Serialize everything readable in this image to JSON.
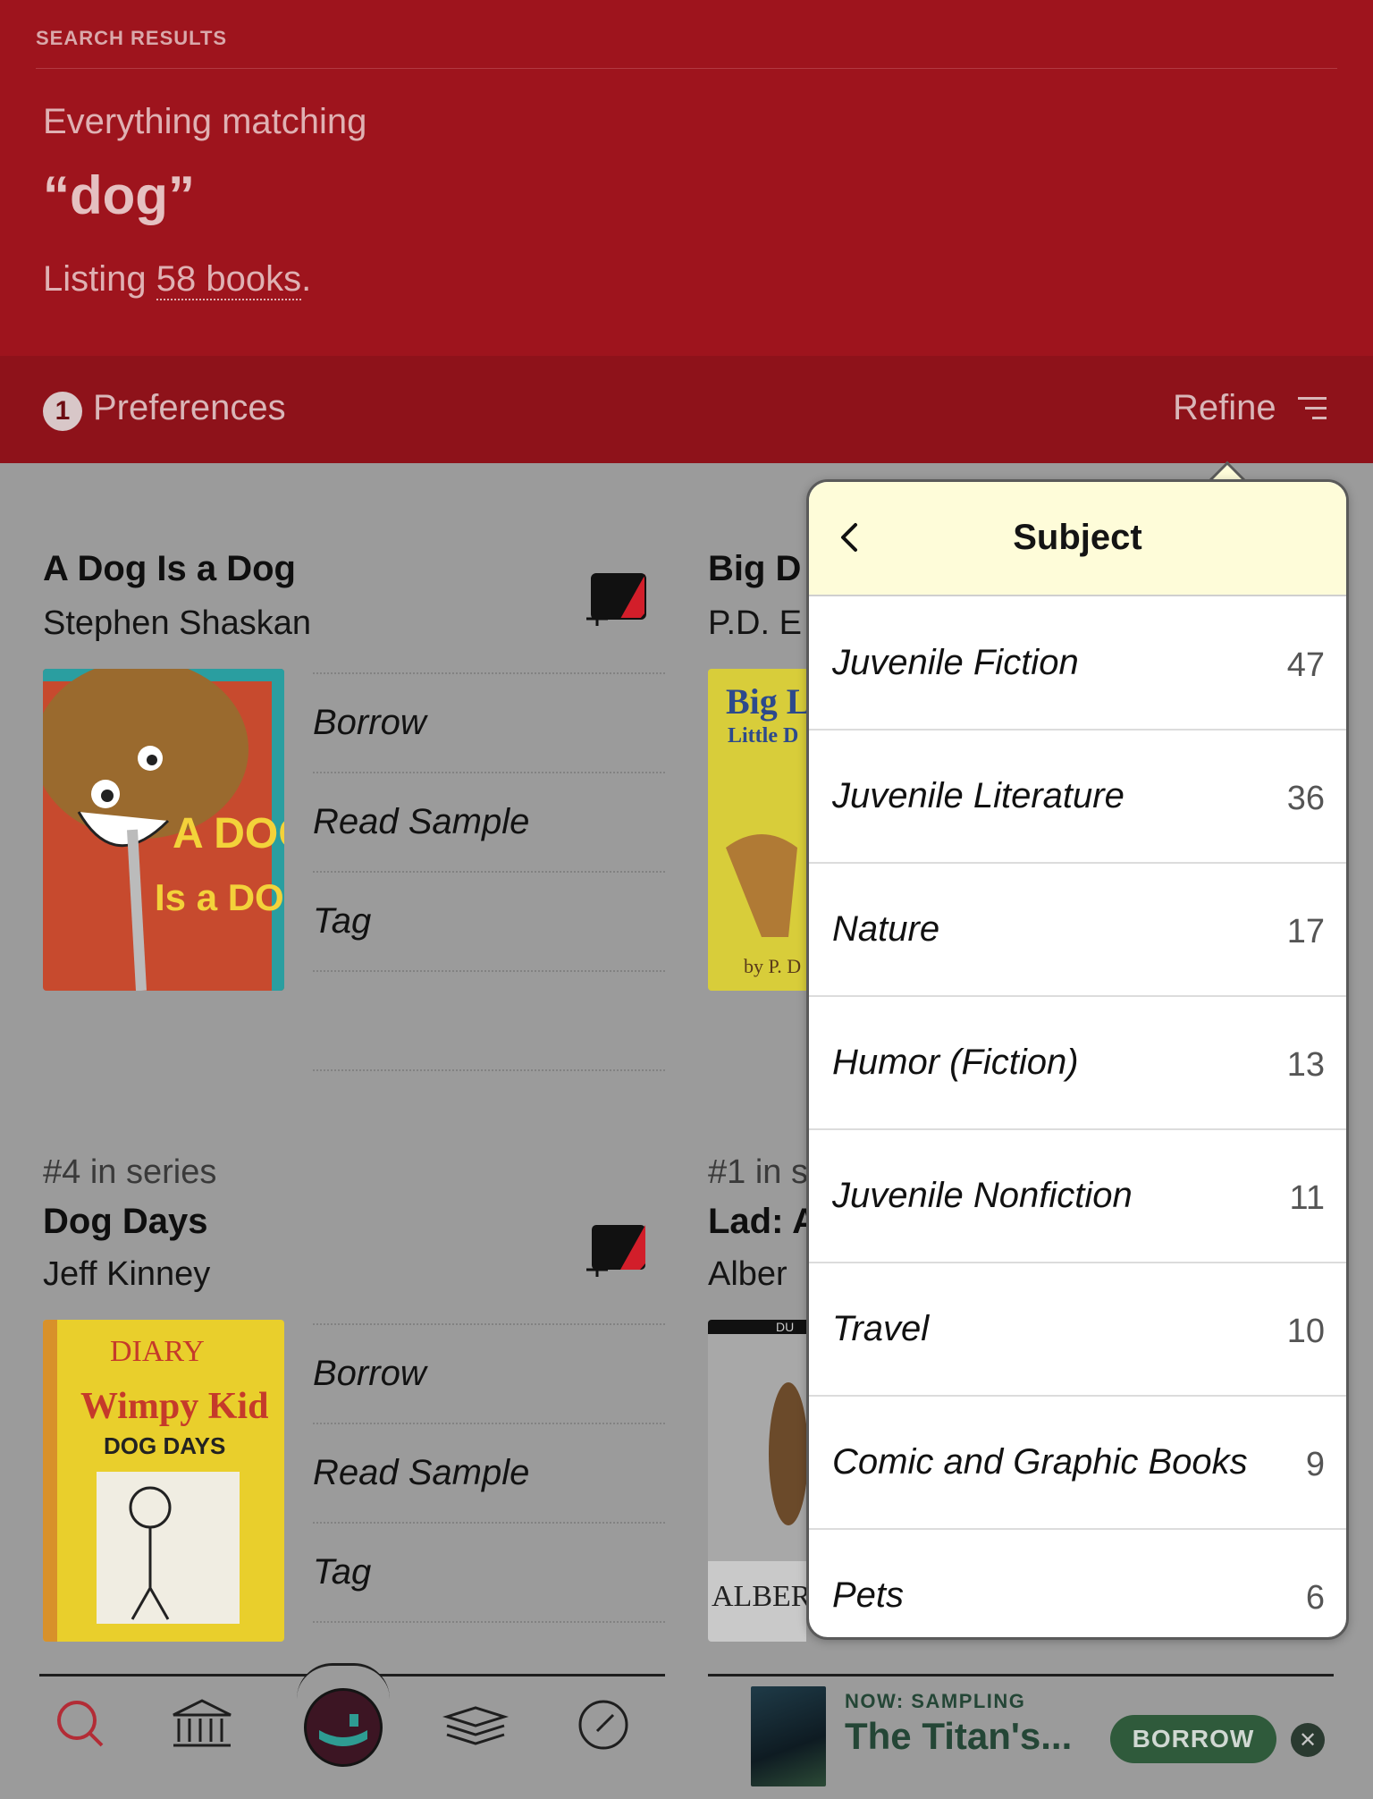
{
  "header": {
    "section_label": "SEARCH RESULTS",
    "everything_text": "Everything matching",
    "query": "“dog”",
    "listing_prefix": "Listing ",
    "listing_link": "58 books",
    "listing_suffix": "."
  },
  "prefbar": {
    "badge": "1",
    "preferences_label": "Preferences",
    "refine_label": "Refine"
  },
  "books": [
    {
      "series": "",
      "title": "A Dog Is a Dog",
      "author": "Stephen Shaskan",
      "cover_text_1": "A DOG",
      "cover_text_2": "Is a DOG"
    },
    {
      "series": "",
      "title": "Big D",
      "author": "P.D. E",
      "cover_text_1": "Big L",
      "cover_text_2": "Little D"
    },
    {
      "series": "#4 in series",
      "title": "Dog Days",
      "author": "Jeff Kinney",
      "cover_text_1": "DIARY",
      "cover_text_2": "Wimpy Kid"
    },
    {
      "series": "#1 in s",
      "title": "Lad: A",
      "author": "Alber",
      "cover_text_1": "DU",
      "cover_text_2": "ALBER"
    }
  ],
  "actions": {
    "borrow": "Borrow",
    "read_sample": "Read Sample",
    "tag": "Tag"
  },
  "popover": {
    "title": "Subject",
    "subjects": [
      {
        "name": "Juvenile Fiction",
        "count": "47"
      },
      {
        "name": "Juvenile Literature",
        "count": "36"
      },
      {
        "name": "Nature",
        "count": "17"
      },
      {
        "name": "Humor (Fiction)",
        "count": "13"
      },
      {
        "name": "Juvenile Nonfiction",
        "count": "11"
      },
      {
        "name": "Travel",
        "count": "10"
      },
      {
        "name": "Comic and Graphic Books",
        "count": "9"
      },
      {
        "name": "Pets",
        "count": "6"
      }
    ]
  },
  "now_sampling": {
    "label": "NOW: SAMPLING",
    "title": "The Titan's...",
    "borrow_label": "BORROW",
    "close_glyph": "✕"
  },
  "nav": {
    "icons": [
      "search-icon",
      "library-icon",
      "shelf-icon",
      "books-stack-icon",
      "clock-icon"
    ]
  },
  "colors": {
    "header_red": "#9e141d",
    "prefbar_red": "#8e121a",
    "popover_header": "#fefcd9",
    "sampling_green": "#2f5a3b"
  }
}
